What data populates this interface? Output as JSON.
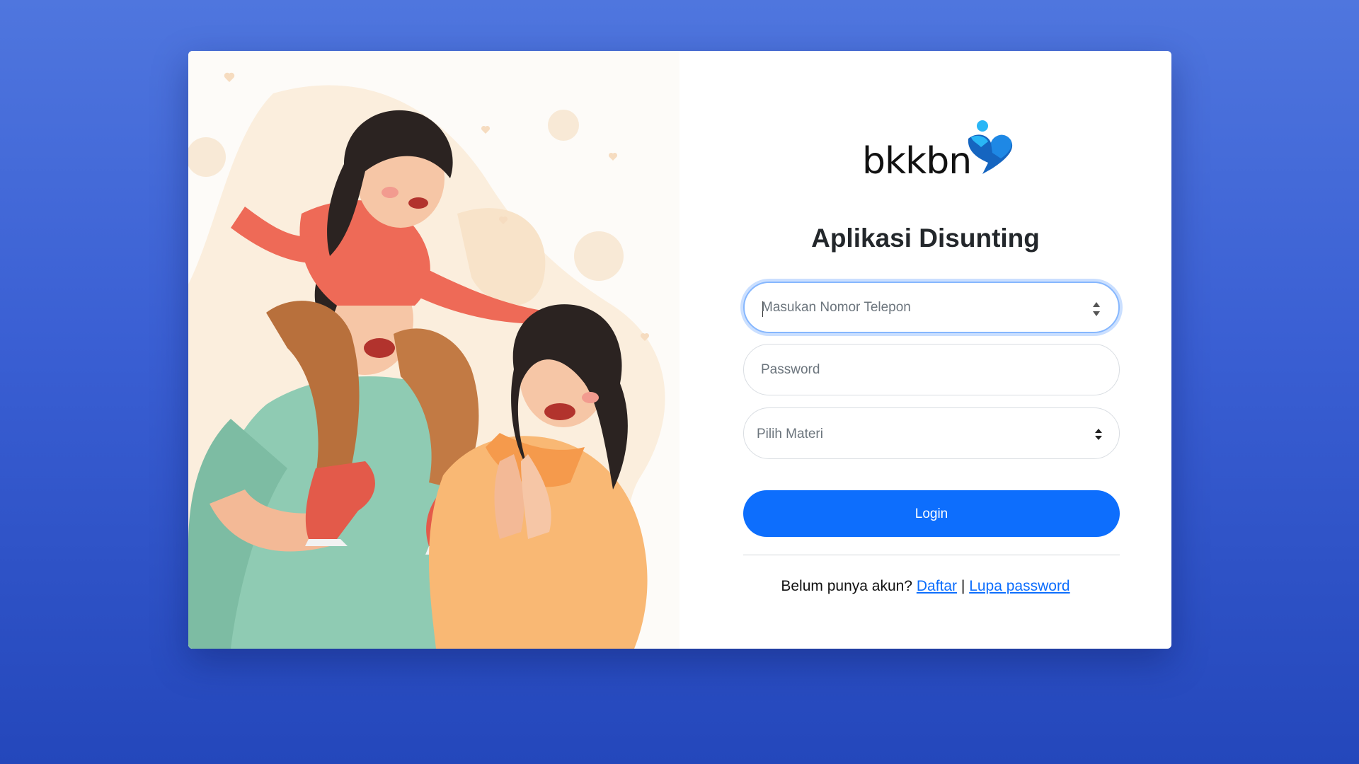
{
  "brand": {
    "logo_text": "bkkbn",
    "app_title": "Aplikasi Disunting"
  },
  "form": {
    "phone": {
      "placeholder": "Masukan Nomor Telepon"
    },
    "password": {
      "placeholder": "Password"
    },
    "materi": {
      "selected": "Pilih Materi"
    },
    "login_label": "Login"
  },
  "footer": {
    "prompt": "Belum punya akun?",
    "register_label": "Daftar",
    "separator": "|",
    "forgot_label": "Lupa password"
  },
  "colors": {
    "background_top": "#4f76de",
    "background_bottom": "#2447bb",
    "primary": "#0d6efd",
    "logo_mark_blue": "#1565c0",
    "logo_mark_light": "#29b6f6"
  }
}
